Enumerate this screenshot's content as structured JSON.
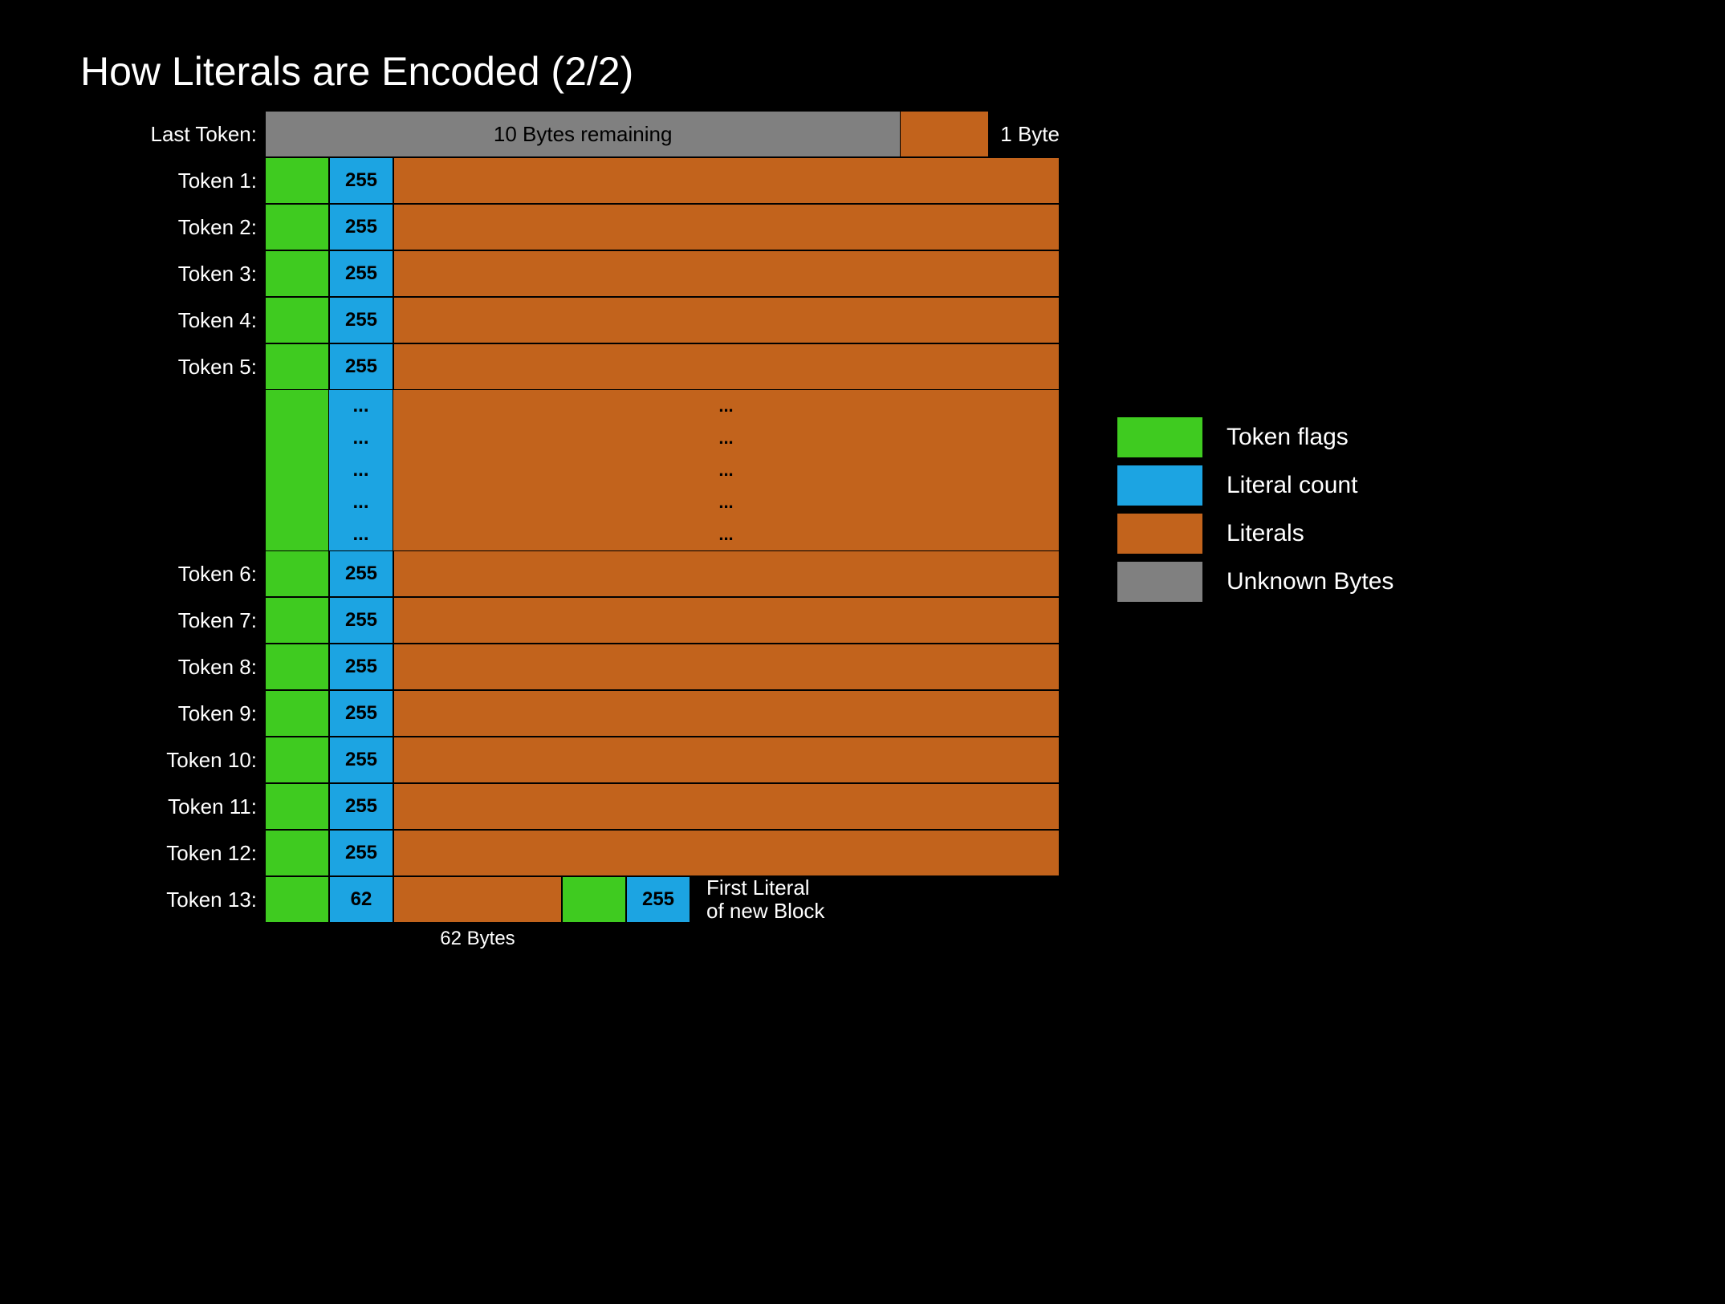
{
  "title": "How Literals are Encoded (2/2)",
  "row_labels": {
    "header": "Last Token:",
    "tok1": "Token 1:",
    "tok2": "Token 2:",
    "tok3": "Token 3:",
    "tok4": "Token 4:",
    "tok5": "Token 5:",
    "tok6": "Token 6:",
    "tok7": "Token 7:",
    "tok8": "Token 8:",
    "tok9": "Token 9:",
    "tok10": "Token 10:",
    "tok11": "Token 11:",
    "tok12": "Token 12:",
    "tok13": "Token 13:"
  },
  "header": {
    "bytes": "10 Bytes remaining",
    "one": "1 Byte"
  },
  "counts": {
    "full": "255",
    "ell": "...",
    "tail_first": "62",
    "tail_second": "255"
  },
  "tail": {
    "seg1_label": "62 Bytes",
    "seg2_label_line1": "First Literal",
    "seg2_label_line2": "of new Block"
  },
  "legend": {
    "flag": "Token flags",
    "count": "Literal count",
    "literals": "Literals",
    "unknown": "Unknown Bytes"
  },
  "colors": {
    "green": "#3fcb20",
    "blue": "#1ca4e2",
    "orange": "#c2631c",
    "grey": "#808080"
  }
}
